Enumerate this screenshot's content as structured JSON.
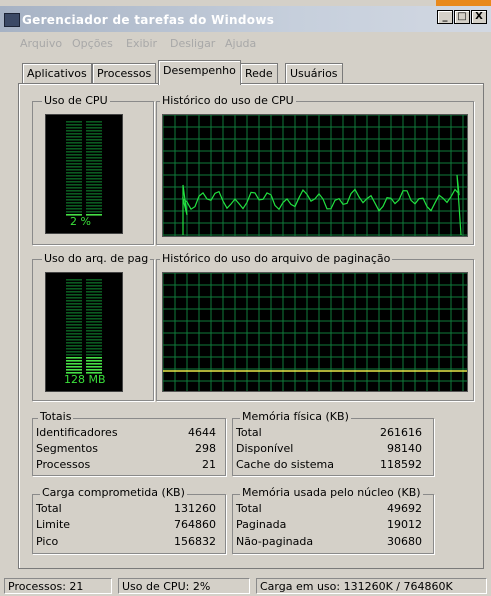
{
  "window": {
    "title": "Gerenciador de tarefas do Windows",
    "buttons": {
      "minimize": "_",
      "maximize": "□",
      "close": "X"
    }
  },
  "menu": [
    "Arquivo",
    "Opções",
    "Exibir",
    "Desligar",
    "Ajuda"
  ],
  "tabs": [
    {
      "label": "Aplicativos",
      "active": false
    },
    {
      "label": "Processos",
      "active": false
    },
    {
      "label": "Desempenho",
      "active": true
    },
    {
      "label": "Rede",
      "active": false
    },
    {
      "label": "Usuários",
      "active": false
    }
  ],
  "cpu": {
    "usage_label": "Uso de CPU",
    "usage_value": "2 %",
    "usage_fraction": 0.02,
    "history_label": "Histórico do uso de CPU"
  },
  "pagefile": {
    "usage_label": "Uso do arq. de pag",
    "usage_value": "128 MB",
    "history_label": "Histórico do uso do arquivo de paginação"
  },
  "totals": {
    "label": "Totais",
    "rows": [
      {
        "name": "Identificadores",
        "value": "4644"
      },
      {
        "name": "Segmentos",
        "value": "298"
      },
      {
        "name": "Processos",
        "value": "21"
      }
    ]
  },
  "physical_memory": {
    "label": "Memória física (KB)",
    "rows": [
      {
        "name": "Total",
        "value": "261616"
      },
      {
        "name": "Disponível",
        "value": "98140"
      },
      {
        "name": "Cache do sistema",
        "value": "118592"
      }
    ]
  },
  "commit_charge": {
    "label": "Carga comprometida (KB)",
    "rows": [
      {
        "name": "Total",
        "value": "131260"
      },
      {
        "name": "Limite",
        "value": "764860"
      },
      {
        "name": "Pico",
        "value": "156832"
      }
    ]
  },
  "kernel_memory": {
    "label": "Memória usada pelo núcleo (KB)",
    "rows": [
      {
        "name": "Total",
        "value": "49692"
      },
      {
        "name": "Paginada",
        "value": "19012"
      },
      {
        "name": "Não-paginada",
        "value": "30680"
      }
    ]
  },
  "status": {
    "processes": "Processos: 21",
    "cpu": "Uso de CPU: 2%",
    "commit": "Carga em uso: 131260K / 764860K"
  },
  "colors": {
    "graph_grid": "#0f7a3a",
    "graph_line": "#22e040",
    "meter_on": "#46e046",
    "meter_off": "#0b5a20",
    "pagefile_line": "#e8e84a"
  }
}
